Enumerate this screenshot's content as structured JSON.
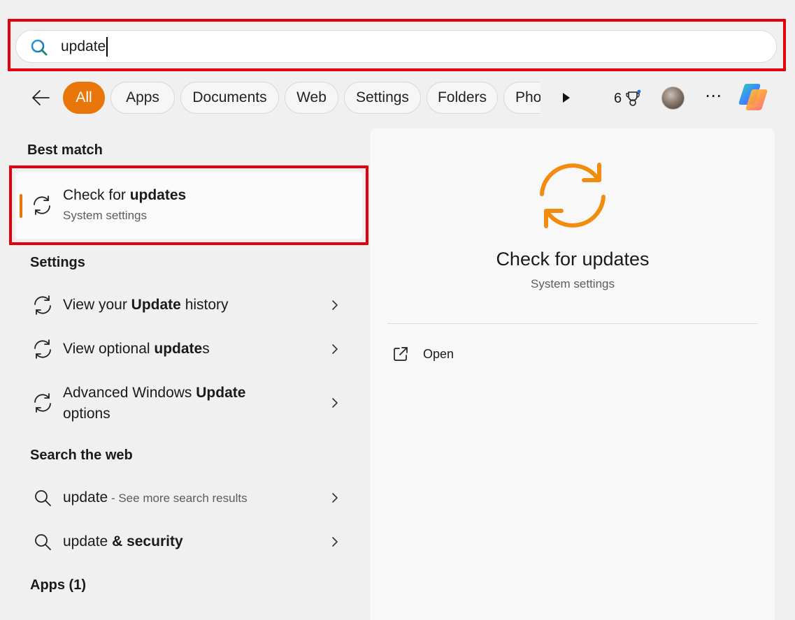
{
  "search": {
    "query": "update"
  },
  "filters": [
    "All",
    "Apps",
    "Documents",
    "Web",
    "Settings",
    "Folders",
    "Photos"
  ],
  "toolbar": {
    "points": "6"
  },
  "best_match": {
    "heading": "Best match",
    "title_prefix": "Check for ",
    "title_bold": "updates",
    "subtitle": "System settings"
  },
  "settings_section": {
    "heading": "Settings",
    "items": [
      {
        "pre": "View your ",
        "bold": "Update",
        "post": " history"
      },
      {
        "pre": "View optional ",
        "bold": "update",
        "post": "s"
      },
      {
        "pre": "Advanced Windows ",
        "bold": "Update",
        "post": "",
        "line2": "options"
      }
    ]
  },
  "web_section": {
    "heading": "Search the web",
    "items": [
      {
        "pre": "update",
        "bold": "",
        "post": "",
        "hint": " - See more search results"
      },
      {
        "pre": "update ",
        "bold": "& security",
        "post": "",
        "hint": ""
      }
    ]
  },
  "apps_section": {
    "heading": "Apps (1)"
  },
  "detail": {
    "title": "Check for updates",
    "subtitle": "System settings",
    "open_label": "Open"
  },
  "colors": {
    "accent": "#e8760a",
    "highlight_red": "#e3000b"
  }
}
